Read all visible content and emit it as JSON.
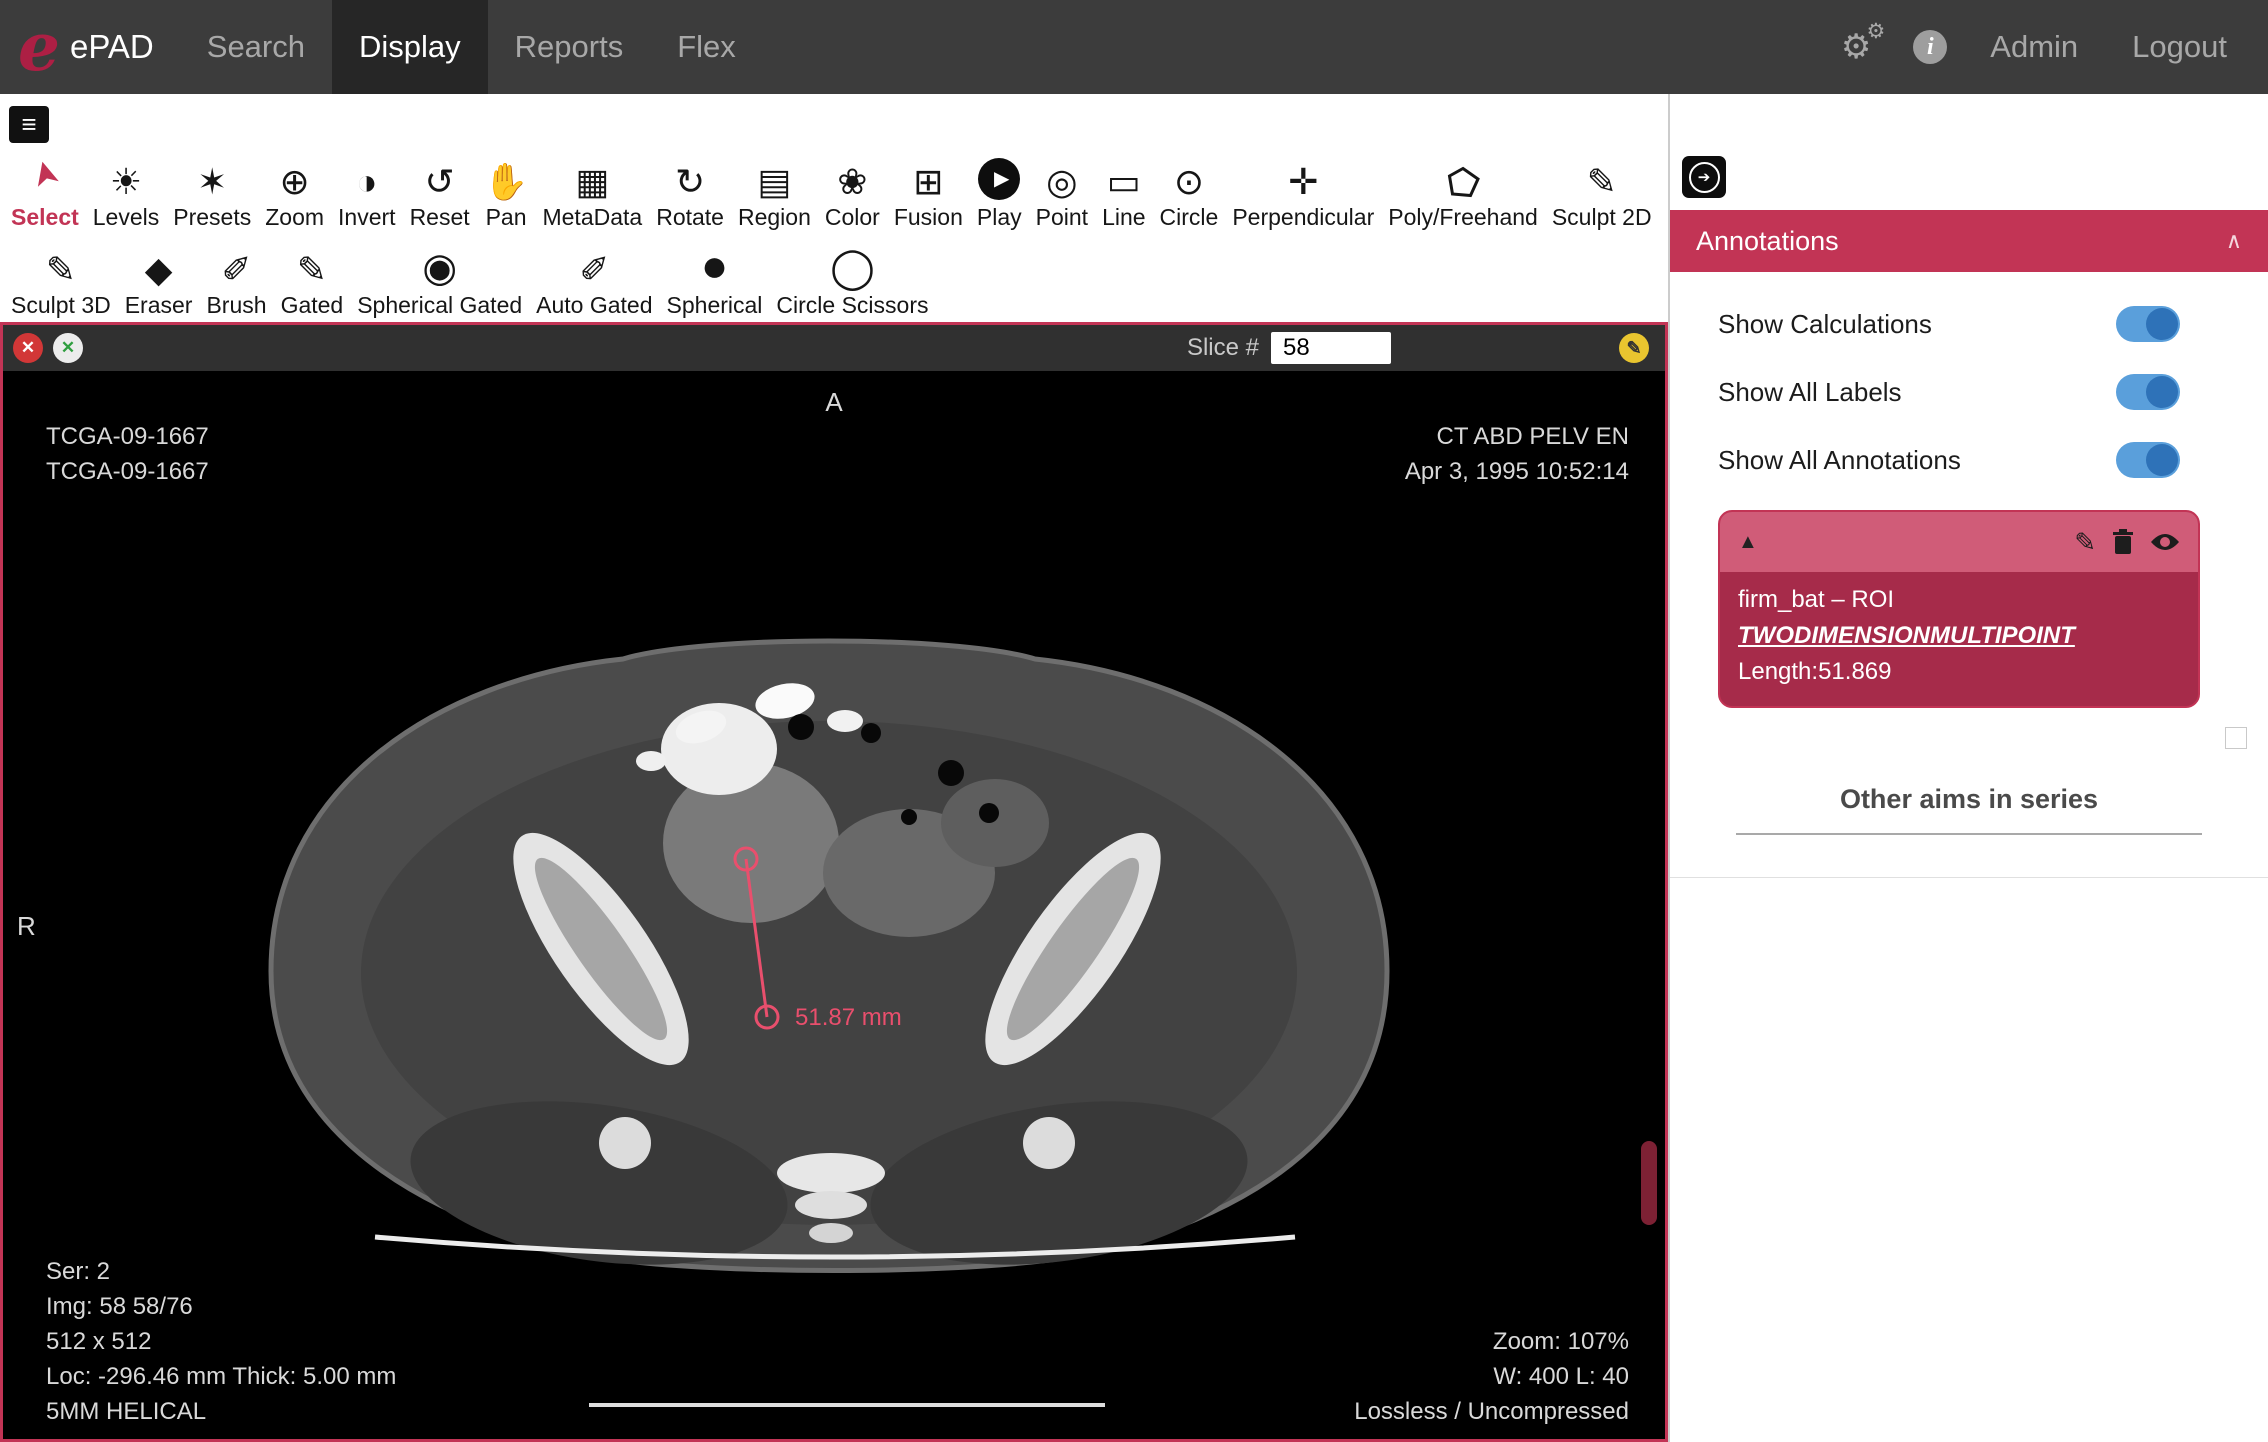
{
  "nav": {
    "brand": {
      "logo_letter": "e",
      "title": "ePAD"
    },
    "items": [
      {
        "label": "Search"
      },
      {
        "label": "Display"
      },
      {
        "label": "Reports"
      },
      {
        "label": "Flex"
      }
    ],
    "icons": {
      "settings_glyph": "⚙",
      "info_glyph": "i"
    },
    "right": {
      "admin": "Admin",
      "logout": "Logout"
    }
  },
  "toolbar": {
    "menu_glyph": "≡",
    "row1": [
      {
        "label": "Select",
        "glyph": "➤"
      },
      {
        "label": "Levels",
        "glyph": "☀"
      },
      {
        "label": "Presets",
        "glyph": "✶"
      },
      {
        "label": "Zoom",
        "glyph": "⊕"
      },
      {
        "label": "Invert",
        "glyph": "◑"
      },
      {
        "label": "Reset",
        "glyph": "↺"
      },
      {
        "label": "Pan",
        "glyph": "✋"
      },
      {
        "label": "MetaData",
        "glyph": "▦"
      },
      {
        "label": "Rotate",
        "glyph": "↻"
      },
      {
        "label": "Region",
        "glyph": "▤"
      },
      {
        "label": "Color",
        "glyph": "❀"
      },
      {
        "label": "Fusion",
        "glyph": "⊞"
      },
      {
        "label": "Play",
        "glyph": "▶"
      },
      {
        "label": "Point",
        "glyph": "◎"
      },
      {
        "label": "Line",
        "glyph": "▭"
      },
      {
        "label": "Circle",
        "glyph": "⊙"
      },
      {
        "label": "Perpendicular",
        "glyph": "✛"
      },
      {
        "label": "Poly/Freehand"
      },
      {
        "label": "Sculpt 2D",
        "glyph": "✎"
      }
    ],
    "row2": [
      {
        "label": "Sculpt 3D",
        "glyph": "✎"
      },
      {
        "label": "Eraser",
        "glyph": "◆"
      },
      {
        "label": "Brush",
        "glyph": "✐"
      },
      {
        "label": "Gated",
        "glyph": "✎"
      },
      {
        "label": "Spherical Gated",
        "glyph": "◉"
      },
      {
        "label": "Auto Gated",
        "glyph": "✐"
      },
      {
        "label": "Spherical",
        "glyph": "●"
      },
      {
        "label": "Circle Scissors",
        "glyph": "◯"
      }
    ]
  },
  "viewer": {
    "header": {
      "close_glyph": "✕",
      "detach_glyph": "✕",
      "slice_label": "Slice #",
      "slice_value": "58",
      "edit_glyph": "✎"
    },
    "overlays": {
      "orientation_top": "A",
      "orientation_left": "R",
      "top_left": [
        "TCGA-09-1667",
        "TCGA-09-1667"
      ],
      "top_right": [
        "CT ABD PELV EN",
        "Apr 3, 1995 10:52:14"
      ],
      "bottom_left": [
        "Ser: 2",
        "Img: 58 58/76",
        "512 x 512",
        "Loc: -296.46 mm Thick: 5.00 mm",
        "5MM HELICAL"
      ],
      "bottom_right": [
        "Zoom: 107%",
        "W: 400 L: 40",
        "Lossless / Uncompressed"
      ]
    },
    "measurement": {
      "label": "51.87 mm"
    }
  },
  "sidebar": {
    "collapse_glyph": "➔",
    "panel_title": "Annotations",
    "caret_glyph": "∧",
    "toggles": [
      {
        "label": "Show Calculations",
        "on": true
      },
      {
        "label": "Show All Labels",
        "on": true
      },
      {
        "label": "Show All Annotations",
        "on": true
      }
    ],
    "annotation": {
      "marker_glyph": "▲",
      "edit_glyph": "✎",
      "name": "firm_bat  –  ROI",
      "type": "TWODIMENSIONMULTIPOINT",
      "length": "Length:51.869"
    },
    "other_aims_title": "Other aims in series"
  },
  "colors": {
    "accent_red": "#c23455",
    "card_header": "#d05c78",
    "card_body": "#a62b4a",
    "toggle_track": "#5a9fdb",
    "toggle_knob": "#2e72b8",
    "measurement": "#e94f6d",
    "nav_bg": "#3c3c3c"
  }
}
